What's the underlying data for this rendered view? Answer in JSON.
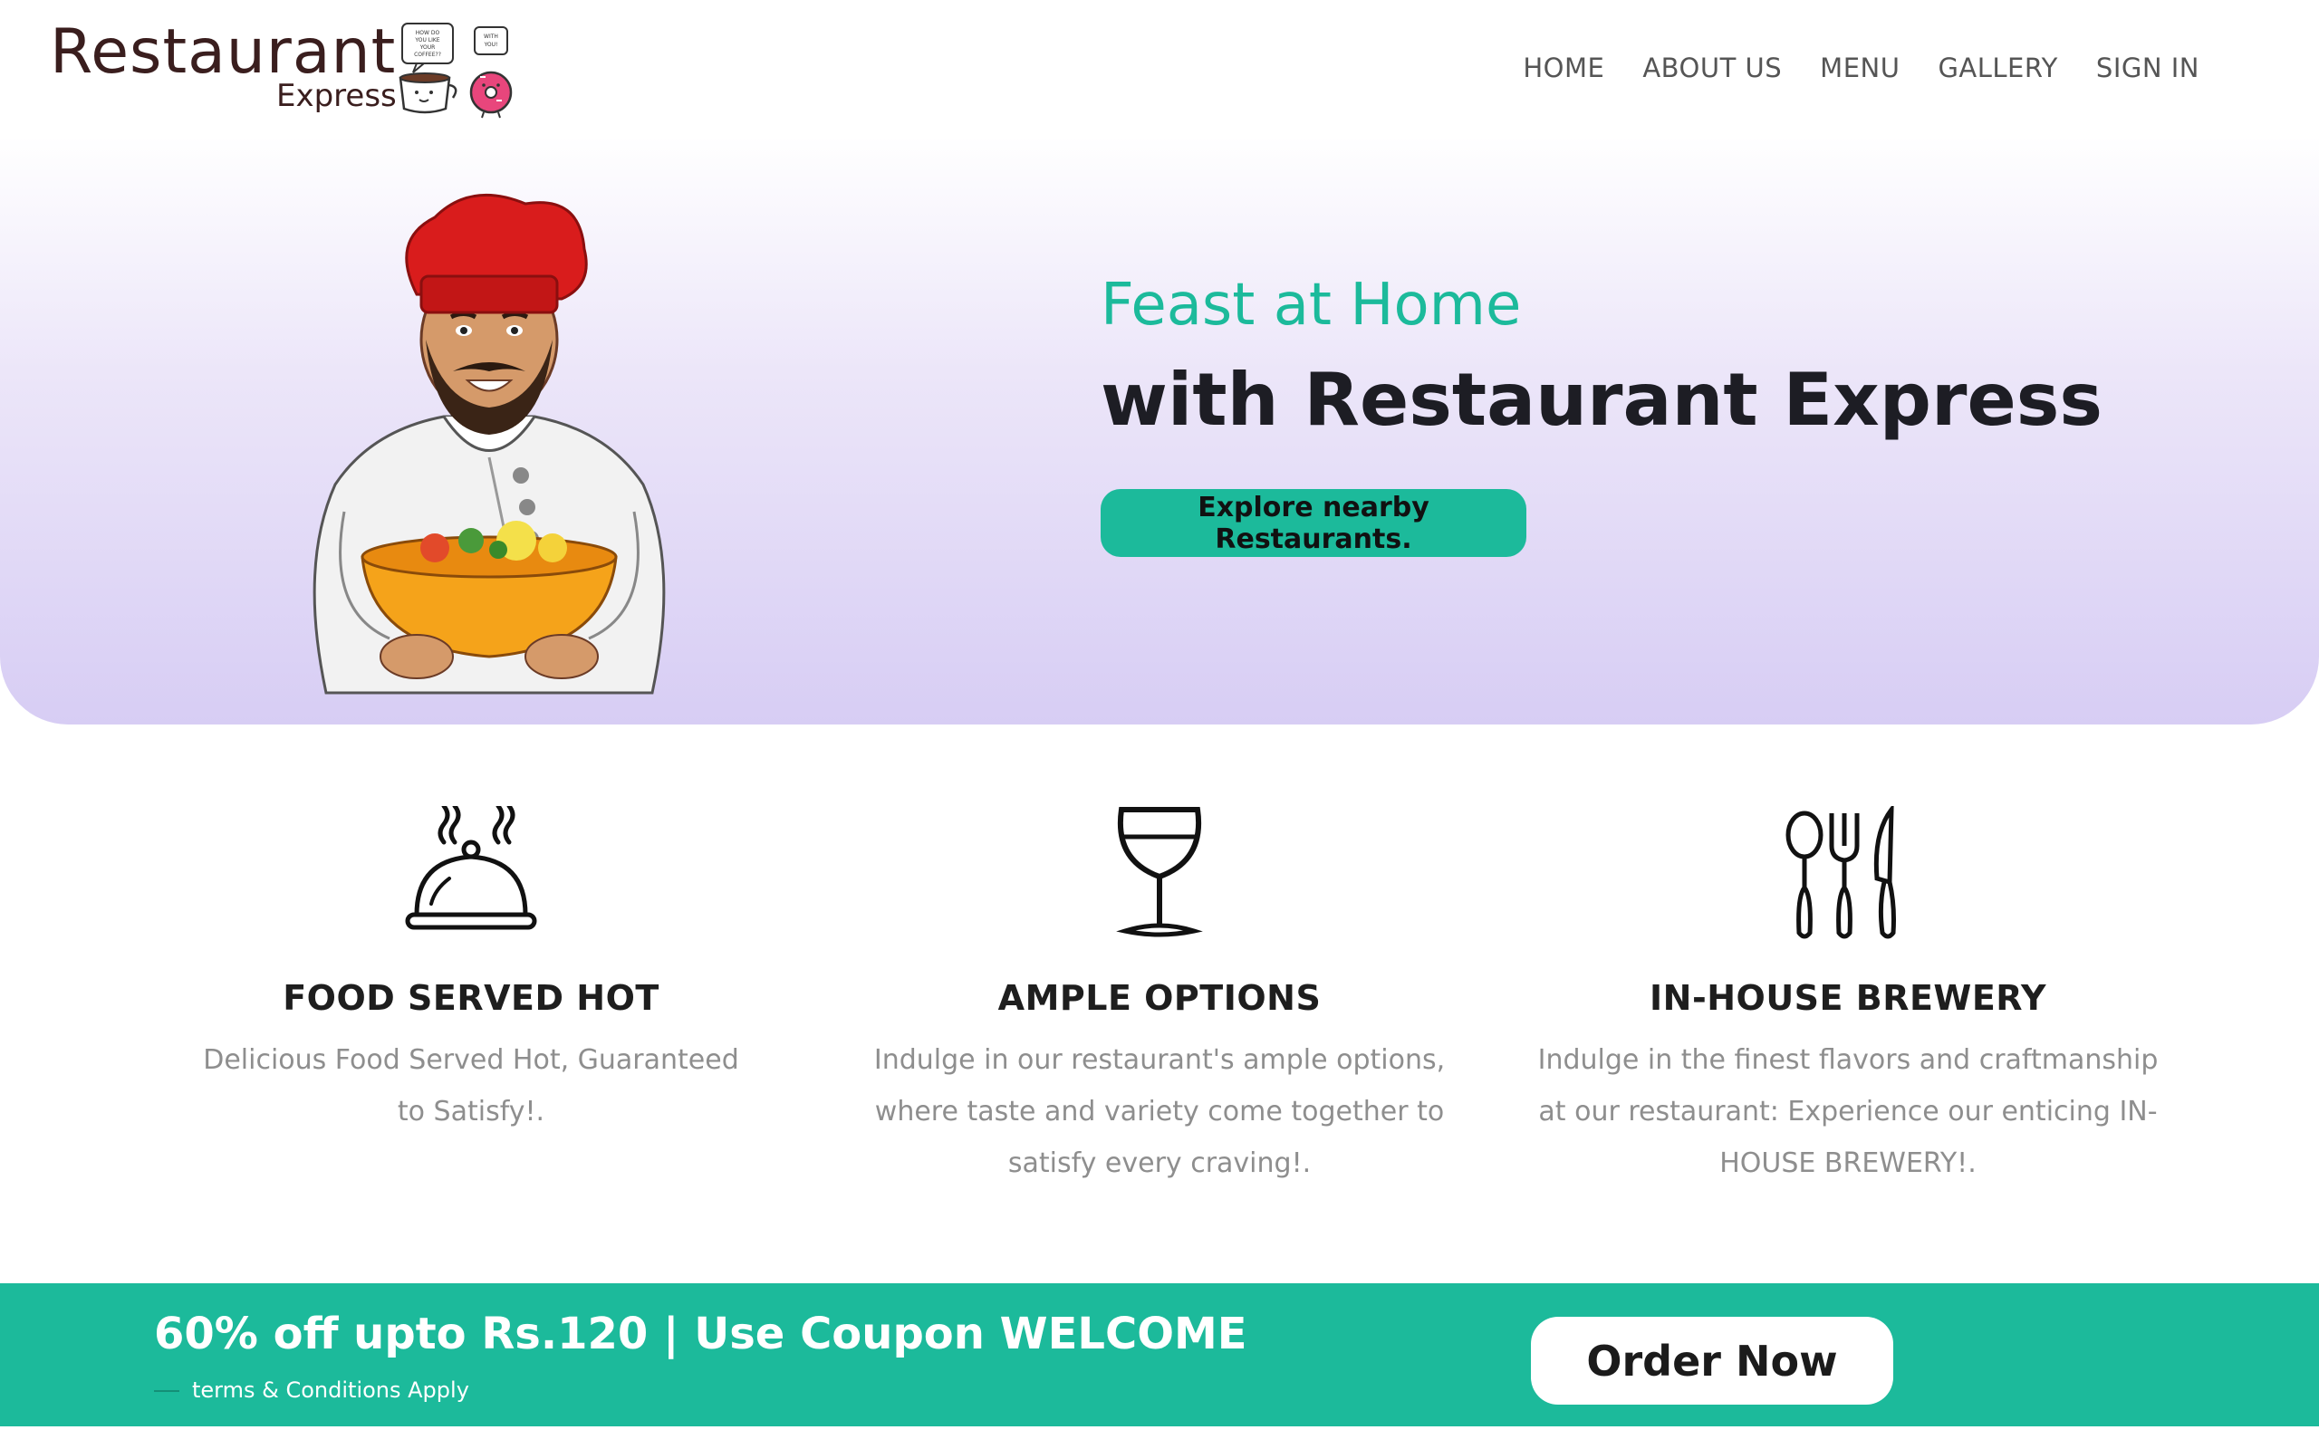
{
  "brand": {
    "title": "Restaurant",
    "subtitle": "Express",
    "art_text_1": "HOW DO YOU LIKE YOUR COFFEE??",
    "art_text_2": "WITH YOU!"
  },
  "nav": {
    "items": [
      {
        "label": "HOME"
      },
      {
        "label": "ABOUT US"
      },
      {
        "label": "MENU"
      },
      {
        "label": "GALLERY"
      },
      {
        "label": "SIGN IN"
      }
    ]
  },
  "hero": {
    "subtitle": "Feast at Home",
    "title": "with Restaurant Express",
    "button_label": "Explore nearby Restaurants."
  },
  "features": [
    {
      "icon": "serving-cloche-icon",
      "title": "FOOD SERVED HOT",
      "description": "Delicious Food Served Hot, Guaranteed to Satisfy!."
    },
    {
      "icon": "wine-glass-icon",
      "title": "AMPLE OPTIONS",
      "description": "Indulge in our restaurant's ample options, where taste and variety come together to satisfy every craving!."
    },
    {
      "icon": "cutlery-icon",
      "title": "IN-HOUSE BREWERY",
      "description": "Indulge in the finest flavors and craftmanship at our restaurant: Experience our enticing IN-HOUSE BREWERY!."
    }
  ],
  "promo": {
    "title": "60% off upto Rs.120 | Use Coupon WELCOME",
    "terms": "terms & Conditions Apply",
    "button_label": "Order Now"
  },
  "colors": {
    "accent": "#1cba9b",
    "brand_text": "#3a1e1e",
    "hero_gradient_end": "#d7cdf4",
    "chef_hat": "#d91c1c",
    "bowl": "#f5a31a"
  }
}
